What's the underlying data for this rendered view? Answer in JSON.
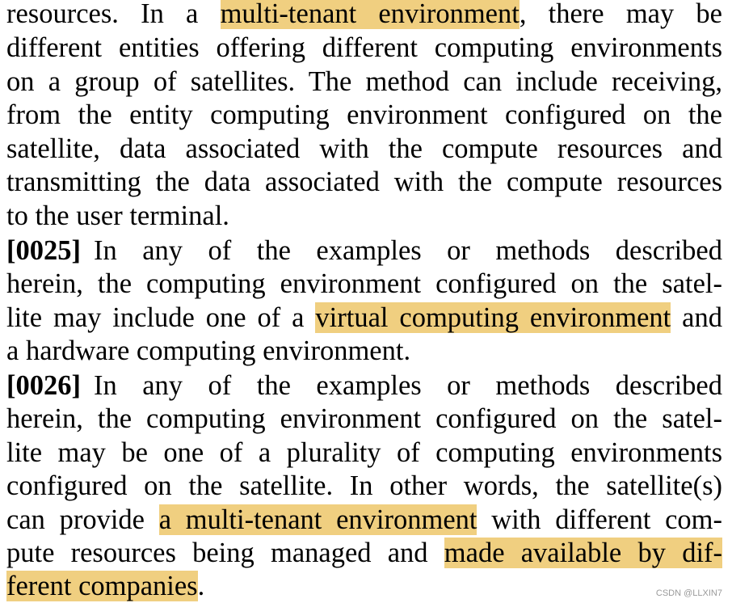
{
  "paragraph_continuation": {
    "line1": {
      "pre": "resources. In a ",
      "hl": "multi-tenant environment",
      "post": ", there may be"
    },
    "line2": "different entities offering different computing environments",
    "line3": "on a group of satellites. The method can include receiving,",
    "line4": "from the entity computing environment configured on the",
    "line5": "satellite, data associated with the compute resources and",
    "line6": "transmitting the data associated with the compute resources",
    "line7": "to the user terminal."
  },
  "paragraph_0025": {
    "number": "[0025]",
    "line1": "In any of the examples or methods described",
    "line2": "herein, the computing environment configured on the satel-",
    "line3": {
      "pre": "lite may include one of a ",
      "hl": "virtual computing environment",
      "post": " and"
    },
    "line4": "a hardware computing environment."
  },
  "paragraph_0026": {
    "number": "[0026]",
    "line1": "In any of the examples or methods described",
    "line2": "herein, the computing environment configured on the satel-",
    "line3": "lite may be one of a plurality of computing environments",
    "line4": "configured on the satellite. In other words, the satellite(s)",
    "line5": {
      "pre": "can provide ",
      "hl": "a multi-tenant environment",
      "post": " with different com-"
    },
    "line6": {
      "pre": "pute resources being managed and ",
      "hl": "made available by dif-"
    },
    "line7": {
      "hl": "ferent companies",
      "post": "."
    }
  },
  "watermark": "CSDN @LLXIN7",
  "colors": {
    "highlight": "#f0cf80",
    "text": "#000000",
    "watermark": "#9a9a9a"
  }
}
